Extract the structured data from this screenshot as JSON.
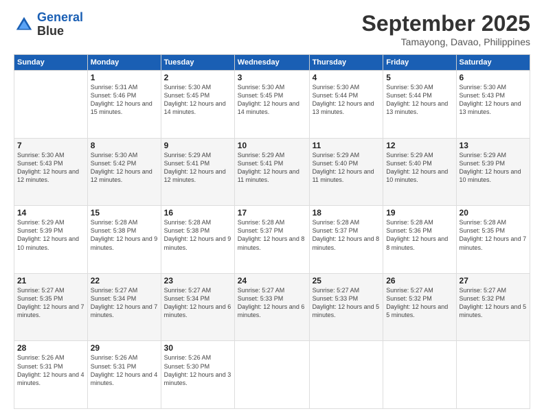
{
  "logo": {
    "line1": "General",
    "line2": "Blue"
  },
  "title": "September 2025",
  "subtitle": "Tamayong, Davao, Philippines",
  "days_of_week": [
    "Sunday",
    "Monday",
    "Tuesday",
    "Wednesday",
    "Thursday",
    "Friday",
    "Saturday"
  ],
  "weeks": [
    [
      {
        "day": "",
        "sunrise": "",
        "sunset": "",
        "daylight": ""
      },
      {
        "day": "1",
        "sunrise": "Sunrise: 5:31 AM",
        "sunset": "Sunset: 5:46 PM",
        "daylight": "Daylight: 12 hours and 15 minutes."
      },
      {
        "day": "2",
        "sunrise": "Sunrise: 5:30 AM",
        "sunset": "Sunset: 5:45 PM",
        "daylight": "Daylight: 12 hours and 14 minutes."
      },
      {
        "day": "3",
        "sunrise": "Sunrise: 5:30 AM",
        "sunset": "Sunset: 5:45 PM",
        "daylight": "Daylight: 12 hours and 14 minutes."
      },
      {
        "day": "4",
        "sunrise": "Sunrise: 5:30 AM",
        "sunset": "Sunset: 5:44 PM",
        "daylight": "Daylight: 12 hours and 13 minutes."
      },
      {
        "day": "5",
        "sunrise": "Sunrise: 5:30 AM",
        "sunset": "Sunset: 5:44 PM",
        "daylight": "Daylight: 12 hours and 13 minutes."
      },
      {
        "day": "6",
        "sunrise": "Sunrise: 5:30 AM",
        "sunset": "Sunset: 5:43 PM",
        "daylight": "Daylight: 12 hours and 13 minutes."
      }
    ],
    [
      {
        "day": "7",
        "sunrise": "Sunrise: 5:30 AM",
        "sunset": "Sunset: 5:43 PM",
        "daylight": "Daylight: 12 hours and 12 minutes."
      },
      {
        "day": "8",
        "sunrise": "Sunrise: 5:30 AM",
        "sunset": "Sunset: 5:42 PM",
        "daylight": "Daylight: 12 hours and 12 minutes."
      },
      {
        "day": "9",
        "sunrise": "Sunrise: 5:29 AM",
        "sunset": "Sunset: 5:41 PM",
        "daylight": "Daylight: 12 hours and 12 minutes."
      },
      {
        "day": "10",
        "sunrise": "Sunrise: 5:29 AM",
        "sunset": "Sunset: 5:41 PM",
        "daylight": "Daylight: 12 hours and 11 minutes."
      },
      {
        "day": "11",
        "sunrise": "Sunrise: 5:29 AM",
        "sunset": "Sunset: 5:40 PM",
        "daylight": "Daylight: 12 hours and 11 minutes."
      },
      {
        "day": "12",
        "sunrise": "Sunrise: 5:29 AM",
        "sunset": "Sunset: 5:40 PM",
        "daylight": "Daylight: 12 hours and 10 minutes."
      },
      {
        "day": "13",
        "sunrise": "Sunrise: 5:29 AM",
        "sunset": "Sunset: 5:39 PM",
        "daylight": "Daylight: 12 hours and 10 minutes."
      }
    ],
    [
      {
        "day": "14",
        "sunrise": "Sunrise: 5:29 AM",
        "sunset": "Sunset: 5:39 PM",
        "daylight": "Daylight: 12 hours and 10 minutes."
      },
      {
        "day": "15",
        "sunrise": "Sunrise: 5:28 AM",
        "sunset": "Sunset: 5:38 PM",
        "daylight": "Daylight: 12 hours and 9 minutes."
      },
      {
        "day": "16",
        "sunrise": "Sunrise: 5:28 AM",
        "sunset": "Sunset: 5:38 PM",
        "daylight": "Daylight: 12 hours and 9 minutes."
      },
      {
        "day": "17",
        "sunrise": "Sunrise: 5:28 AM",
        "sunset": "Sunset: 5:37 PM",
        "daylight": "Daylight: 12 hours and 8 minutes."
      },
      {
        "day": "18",
        "sunrise": "Sunrise: 5:28 AM",
        "sunset": "Sunset: 5:37 PM",
        "daylight": "Daylight: 12 hours and 8 minutes."
      },
      {
        "day": "19",
        "sunrise": "Sunrise: 5:28 AM",
        "sunset": "Sunset: 5:36 PM",
        "daylight": "Daylight: 12 hours and 8 minutes."
      },
      {
        "day": "20",
        "sunrise": "Sunrise: 5:28 AM",
        "sunset": "Sunset: 5:35 PM",
        "daylight": "Daylight: 12 hours and 7 minutes."
      }
    ],
    [
      {
        "day": "21",
        "sunrise": "Sunrise: 5:27 AM",
        "sunset": "Sunset: 5:35 PM",
        "daylight": "Daylight: 12 hours and 7 minutes."
      },
      {
        "day": "22",
        "sunrise": "Sunrise: 5:27 AM",
        "sunset": "Sunset: 5:34 PM",
        "daylight": "Daylight: 12 hours and 7 minutes."
      },
      {
        "day": "23",
        "sunrise": "Sunrise: 5:27 AM",
        "sunset": "Sunset: 5:34 PM",
        "daylight": "Daylight: 12 hours and 6 minutes."
      },
      {
        "day": "24",
        "sunrise": "Sunrise: 5:27 AM",
        "sunset": "Sunset: 5:33 PM",
        "daylight": "Daylight: 12 hours and 6 minutes."
      },
      {
        "day": "25",
        "sunrise": "Sunrise: 5:27 AM",
        "sunset": "Sunset: 5:33 PM",
        "daylight": "Daylight: 12 hours and 5 minutes."
      },
      {
        "day": "26",
        "sunrise": "Sunrise: 5:27 AM",
        "sunset": "Sunset: 5:32 PM",
        "daylight": "Daylight: 12 hours and 5 minutes."
      },
      {
        "day": "27",
        "sunrise": "Sunrise: 5:27 AM",
        "sunset": "Sunset: 5:32 PM",
        "daylight": "Daylight: 12 hours and 5 minutes."
      }
    ],
    [
      {
        "day": "28",
        "sunrise": "Sunrise: 5:26 AM",
        "sunset": "Sunset: 5:31 PM",
        "daylight": "Daylight: 12 hours and 4 minutes."
      },
      {
        "day": "29",
        "sunrise": "Sunrise: 5:26 AM",
        "sunset": "Sunset: 5:31 PM",
        "daylight": "Daylight: 12 hours and 4 minutes."
      },
      {
        "day": "30",
        "sunrise": "Sunrise: 5:26 AM",
        "sunset": "Sunset: 5:30 PM",
        "daylight": "Daylight: 12 hours and 3 minutes."
      },
      {
        "day": "",
        "sunrise": "",
        "sunset": "",
        "daylight": ""
      },
      {
        "day": "",
        "sunrise": "",
        "sunset": "",
        "daylight": ""
      },
      {
        "day": "",
        "sunrise": "",
        "sunset": "",
        "daylight": ""
      },
      {
        "day": "",
        "sunrise": "",
        "sunset": "",
        "daylight": ""
      }
    ]
  ]
}
